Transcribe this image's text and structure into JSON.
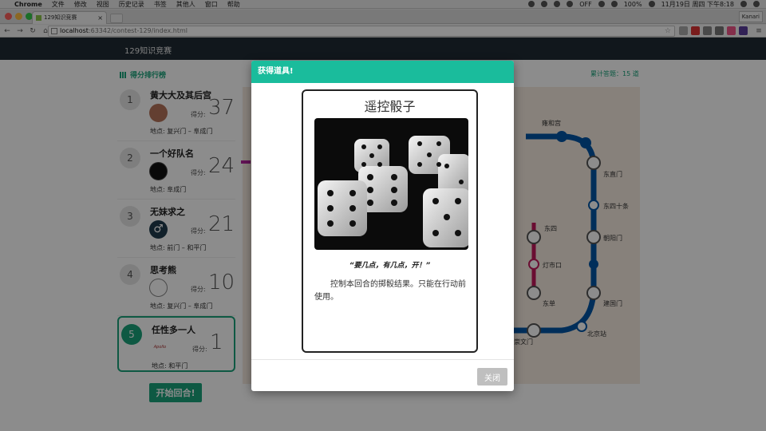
{
  "menubar": {
    "app": "Chrome",
    "items": [
      "文件",
      "修改",
      "视图",
      "历史记录",
      "书签",
      "其他人",
      "窗口",
      "帮助"
    ],
    "status": {
      "off_label": "OFF",
      "battery": "100%",
      "datetime": "11月19日 周四 下午8:18"
    }
  },
  "browser": {
    "tab_title": "129知识竞赛",
    "tab_close": "×",
    "profile": "Kanari",
    "url_host": "localhost",
    "url_path": ":63342/contest-129/index.html",
    "star": "☆"
  },
  "page": {
    "brand": "129知识竞赛",
    "leaderboard_title": "得分排行榜",
    "total_label": "累计答题：",
    "total_value": "15 道",
    "score_label": "得分:",
    "location_label": "地点:",
    "teams": [
      {
        "rank": "1",
        "name": "黄大大及其后宫",
        "score": "37",
        "location": "复兴门 – 阜成门"
      },
      {
        "rank": "2",
        "name": "一个好队名",
        "score": "24",
        "location": "阜成门"
      },
      {
        "rank": "3",
        "name": "无妹求之",
        "score": "21",
        "location": "前门 – 和平门"
      },
      {
        "rank": "4",
        "name": "思考熊",
        "score": "10",
        "location": "复兴门 – 阜成门"
      },
      {
        "rank": "5",
        "name": "任性多一人",
        "score": "1",
        "location": "和平门"
      }
    ],
    "avatar_text_5": "Apollo",
    "start_button": "开始回合!"
  },
  "modal": {
    "header": "获得道具!",
    "card_title": "遥控骰子",
    "quote": "“要几点，有几点，开！”",
    "description": "控制本回合的掷骰结果。只能在行动前使用。",
    "close_button": "关闭"
  },
  "map": {
    "stations": [
      "雍和宫",
      "东直门",
      "东四十条",
      "朝阳门",
      "建国门",
      "北京站",
      "东四",
      "灯市口",
      "东单",
      "崇文门"
    ]
  },
  "colors": {
    "accent": "#1aa37a",
    "modal_header": "#1abc9c",
    "navbar": "#1f2a33",
    "line2": "#0055a5"
  }
}
